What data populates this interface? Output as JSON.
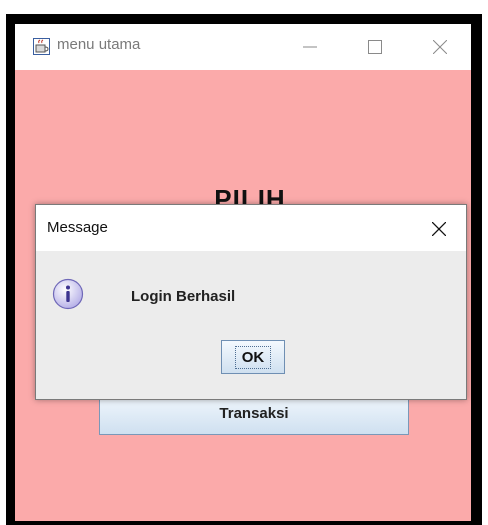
{
  "window": {
    "title": "menu utama",
    "app_icon": "java-cup-icon",
    "controls": [
      "minimize-icon",
      "maximize-icon",
      "close-icon"
    ],
    "background_color": "#fbaaaa"
  },
  "main": {
    "heading": "PILIH",
    "menu_button_label": "Transaksi"
  },
  "dialog": {
    "title": "Message",
    "close_icon": "close-icon",
    "icon": "info-icon",
    "message": "Login Berhasil",
    "ok_label": "OK"
  },
  "colors": {
    "window_bg": "#fbaaaa",
    "dialog_bg": "#ececec",
    "button_border": "#7a98b8"
  }
}
